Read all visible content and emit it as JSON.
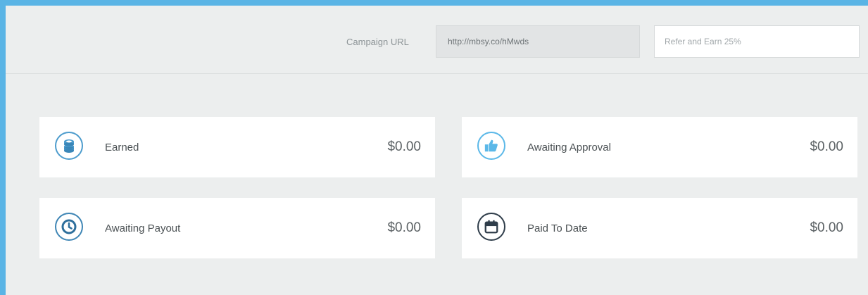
{
  "header": {
    "campaign_label": "Campaign URL",
    "campaign_url": "http://mbsy.co/hMwds",
    "refer_placeholder": "Refer and Earn 25%"
  },
  "stats": [
    {
      "label": "Earned",
      "amount": "$0.00",
      "icon": "coins-icon",
      "color": "#4d9ccd"
    },
    {
      "label": "Awaiting Approval",
      "amount": "$0.00",
      "icon": "thumbs-up-icon",
      "color": "#5bb8e8"
    },
    {
      "label": "Awaiting Payout",
      "amount": "$0.00",
      "icon": "clock-icon",
      "color": "#3f86b5"
    },
    {
      "label": "Paid To Date",
      "amount": "$0.00",
      "icon": "calendar-icon",
      "color": "#2f3d4a"
    }
  ]
}
